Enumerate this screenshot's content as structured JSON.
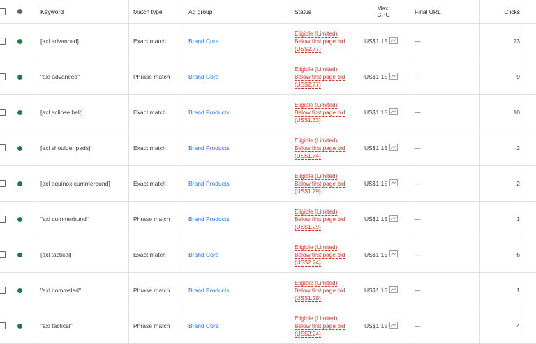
{
  "headers": {
    "keyword": "Keyword",
    "match_type": "Match type",
    "ad_group": "Ad group",
    "status": "Status",
    "max_cpc_line1": "Max.",
    "max_cpc_line2": "CPC",
    "final_url": "Final URL",
    "clicks": "Clicks"
  },
  "rows": [
    {
      "keyword": "[axl advanced]",
      "match_type": "Exact match",
      "ad_group": "Brand Core",
      "status": "Eligible (Limited)",
      "status_detail": "Below first page bid",
      "status_bid": "(US$2.77)",
      "max_cpc": "US$1.15",
      "final_url": "—",
      "clicks": "23"
    },
    {
      "keyword": "\"axl advanced\"",
      "match_type": "Phrase match",
      "ad_group": "Brand Core",
      "status": "Eligible (Limited)",
      "status_detail": "Below first page bid",
      "status_bid": "(US$2.77)",
      "max_cpc": "US$1.15",
      "final_url": "—",
      "clicks": "9"
    },
    {
      "keyword": "[axl eclipse belt]",
      "match_type": "Exact match",
      "ad_group": "Brand Products",
      "status": "Eligible (Limited)",
      "status_detail": "Below first page bid",
      "status_bid": "(US$1.33)",
      "max_cpc": "US$1.15",
      "final_url": "—",
      "clicks": "10"
    },
    {
      "keyword": "[axl shoulder pads]",
      "match_type": "Exact match",
      "ad_group": "Brand Products",
      "status": "Eligible (Limited)",
      "status_detail": "Below first page bid",
      "status_bid": "(US$1.74)",
      "max_cpc": "US$1.15",
      "final_url": "—",
      "clicks": "2"
    },
    {
      "keyword": "[axl equinox cummerbund]",
      "match_type": "Exact match",
      "ad_group": "Brand Products",
      "status": "Eligible (Limited)",
      "status_detail": "Below first page bid",
      "status_bid": "(US$1.29)",
      "max_cpc": "US$1.15",
      "final_url": "—",
      "clicks": "2"
    },
    {
      "keyword": "\"axl cummerbund\"",
      "match_type": "Phrase match",
      "ad_group": "Brand Products",
      "status": "Eligible (Limited)",
      "status_detail": "Below first page bid",
      "status_bid": "(US$1.29)",
      "max_cpc": "US$1.15",
      "final_url": "—",
      "clicks": "1"
    },
    {
      "keyword": "[axl tactical]",
      "match_type": "Exact match",
      "ad_group": "Brand Core",
      "status": "Eligible (Limited)",
      "status_detail": "Below first page bid",
      "status_bid": "(US$2.24)",
      "max_cpc": "US$1.15",
      "final_url": "—",
      "clicks": "6"
    },
    {
      "keyword": "\"axl commsled\"",
      "match_type": "Phrase match",
      "ad_group": "Brand Products",
      "status": "Eligible (Limited)",
      "status_detail": "Below first page bid",
      "status_bid": "(US$1.29)",
      "max_cpc": "US$1.15",
      "final_url": "—",
      "clicks": "1"
    },
    {
      "keyword": "\"axl tactical\"",
      "match_type": "Phrase match",
      "ad_group": "Brand Core",
      "status": "Eligible (Limited)",
      "status_detail": "Below first page bid",
      "status_bid": "(US$2.24)",
      "max_cpc": "US$1.15",
      "final_url": "—",
      "clicks": "4"
    }
  ],
  "colors": {
    "status_red": "#d93025",
    "link_blue": "#1a73e8",
    "enabled_green": "#188038"
  },
  "icons": {
    "row_status": "green-dot-icon",
    "cpc_chart": "bid-simulator-icon"
  }
}
